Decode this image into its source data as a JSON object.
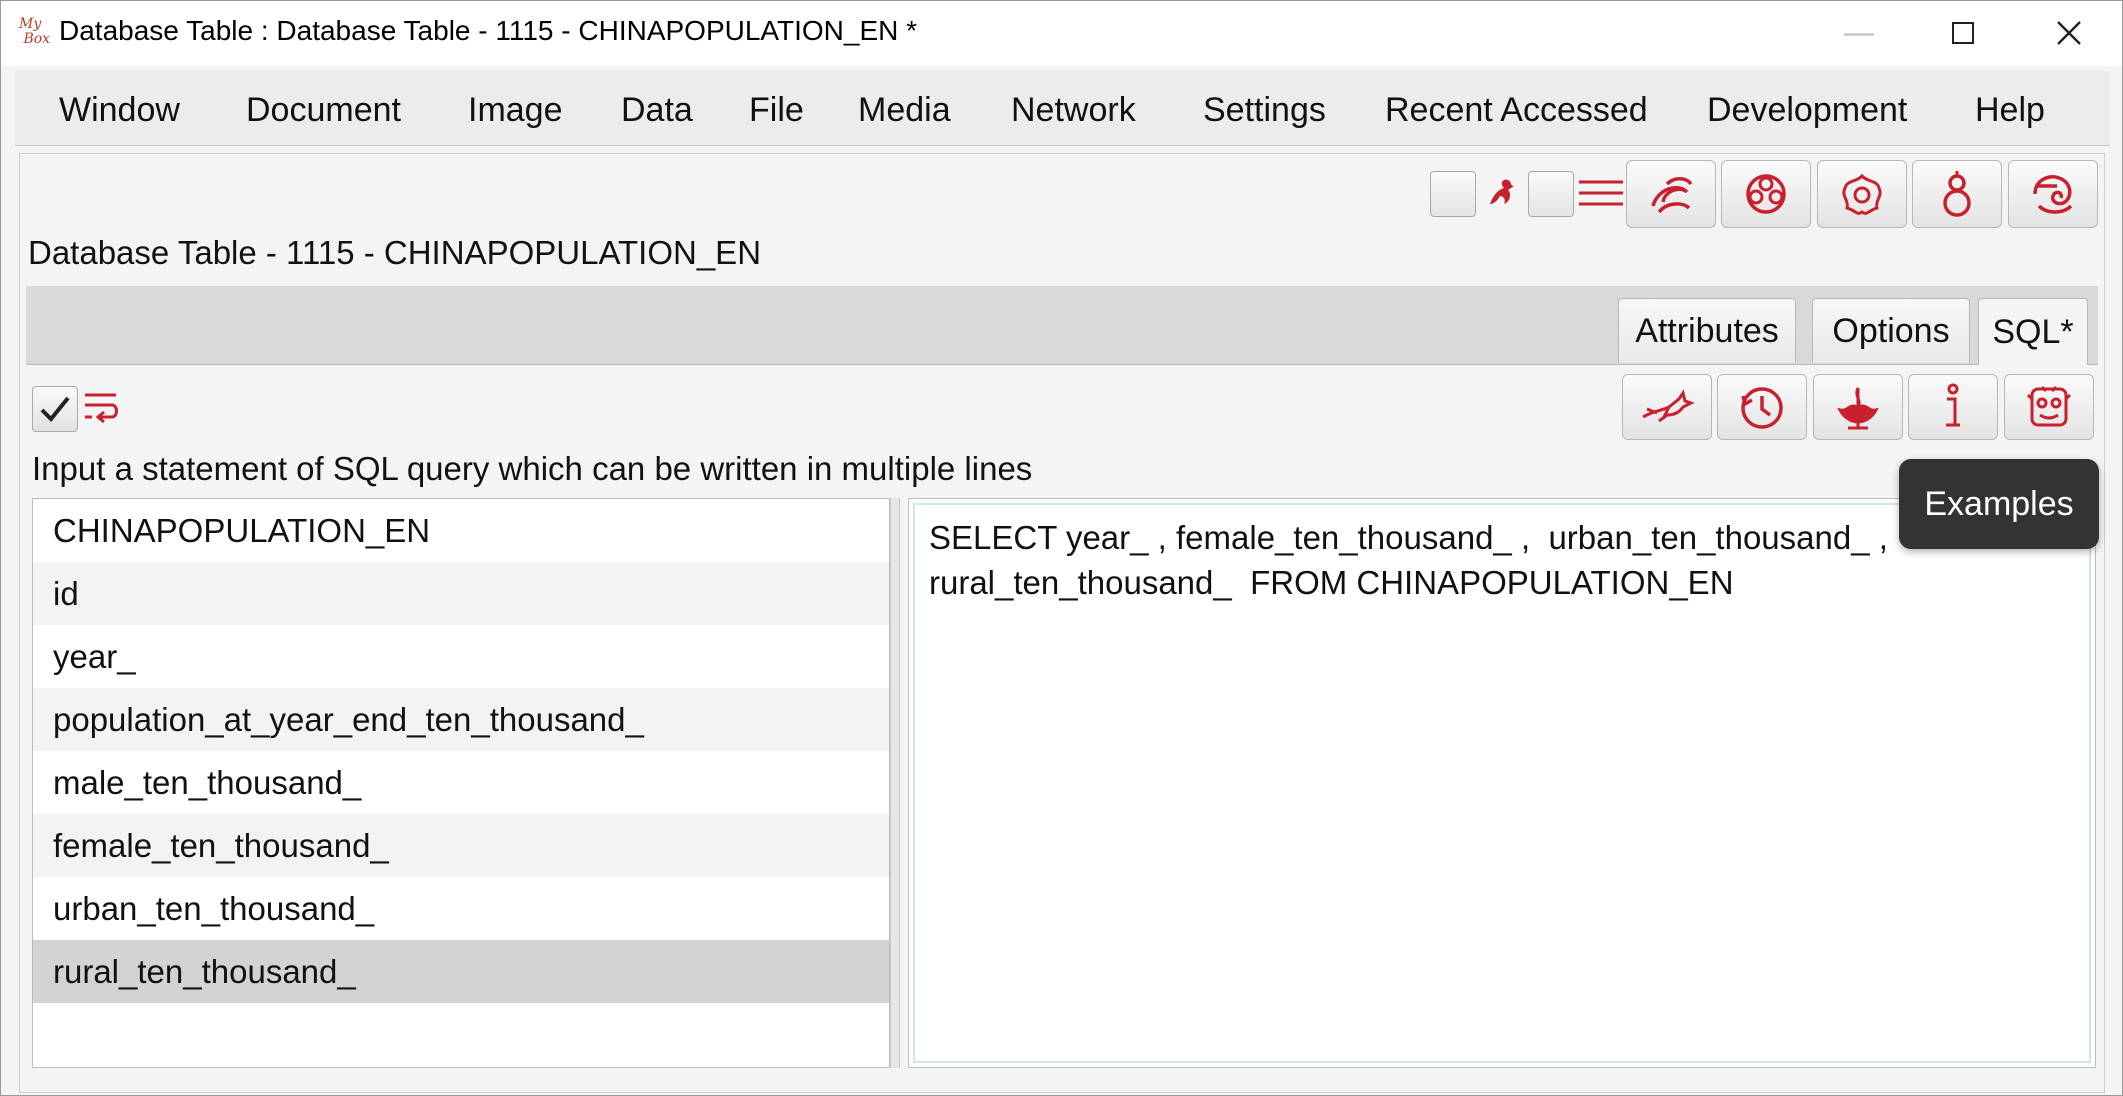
{
  "window": {
    "title": "Database Table : Database Table - 1115 - CHINAPOPULATION_EN *",
    "app_logo_text": "My Box"
  },
  "menubar": {
    "items": [
      "Window",
      "Document",
      "Image",
      "Data",
      "File",
      "Media",
      "Network",
      "Settings",
      "Recent Accessed",
      "Development",
      "Help"
    ]
  },
  "toolbar": {
    "icons": [
      "phoenix-icon",
      "lines-icon",
      "swirl-icon",
      "flower-icon",
      "peony-icon",
      "gourd-icon",
      "cloud-swirl-icon"
    ]
  },
  "page": {
    "title": "Database Table - 1115 - CHINAPOPULATION_EN"
  },
  "tabs": [
    {
      "label": "Attributes",
      "active": false
    },
    {
      "label": "Options",
      "active": false
    },
    {
      "label": "SQL*",
      "active": true
    }
  ],
  "sql": {
    "hint": "Input a statement of SQL query which can be written in multiple lines",
    "query_line1": "SELECT year_ , female_ten_thousand_ ,  urban_ten_thousand_ ,",
    "query_line2": "rural_ten_thousand_  FROM CHINAPOPULATION_EN",
    "actions": [
      "run-icon",
      "history-icon",
      "clear-icon",
      "info-icon",
      "examples-icon"
    ],
    "tooltip": "Examples"
  },
  "fields": [
    {
      "name": "CHINAPOPULATION_EN",
      "selected": false
    },
    {
      "name": "id",
      "selected": false
    },
    {
      "name": "year_",
      "selected": false
    },
    {
      "name": "population_at_year_end_ten_thousand_",
      "selected": false
    },
    {
      "name": "male_ten_thousand_",
      "selected": false
    },
    {
      "name": "female_ten_thousand_",
      "selected": false
    },
    {
      "name": "urban_ten_thousand_",
      "selected": false
    },
    {
      "name": "rural_ten_thousand_",
      "selected": true
    }
  ],
  "colors": {
    "icon_red": "#c8202e",
    "tooltip_bg": "#333333",
    "selected_row": "#d3d3d3"
  }
}
